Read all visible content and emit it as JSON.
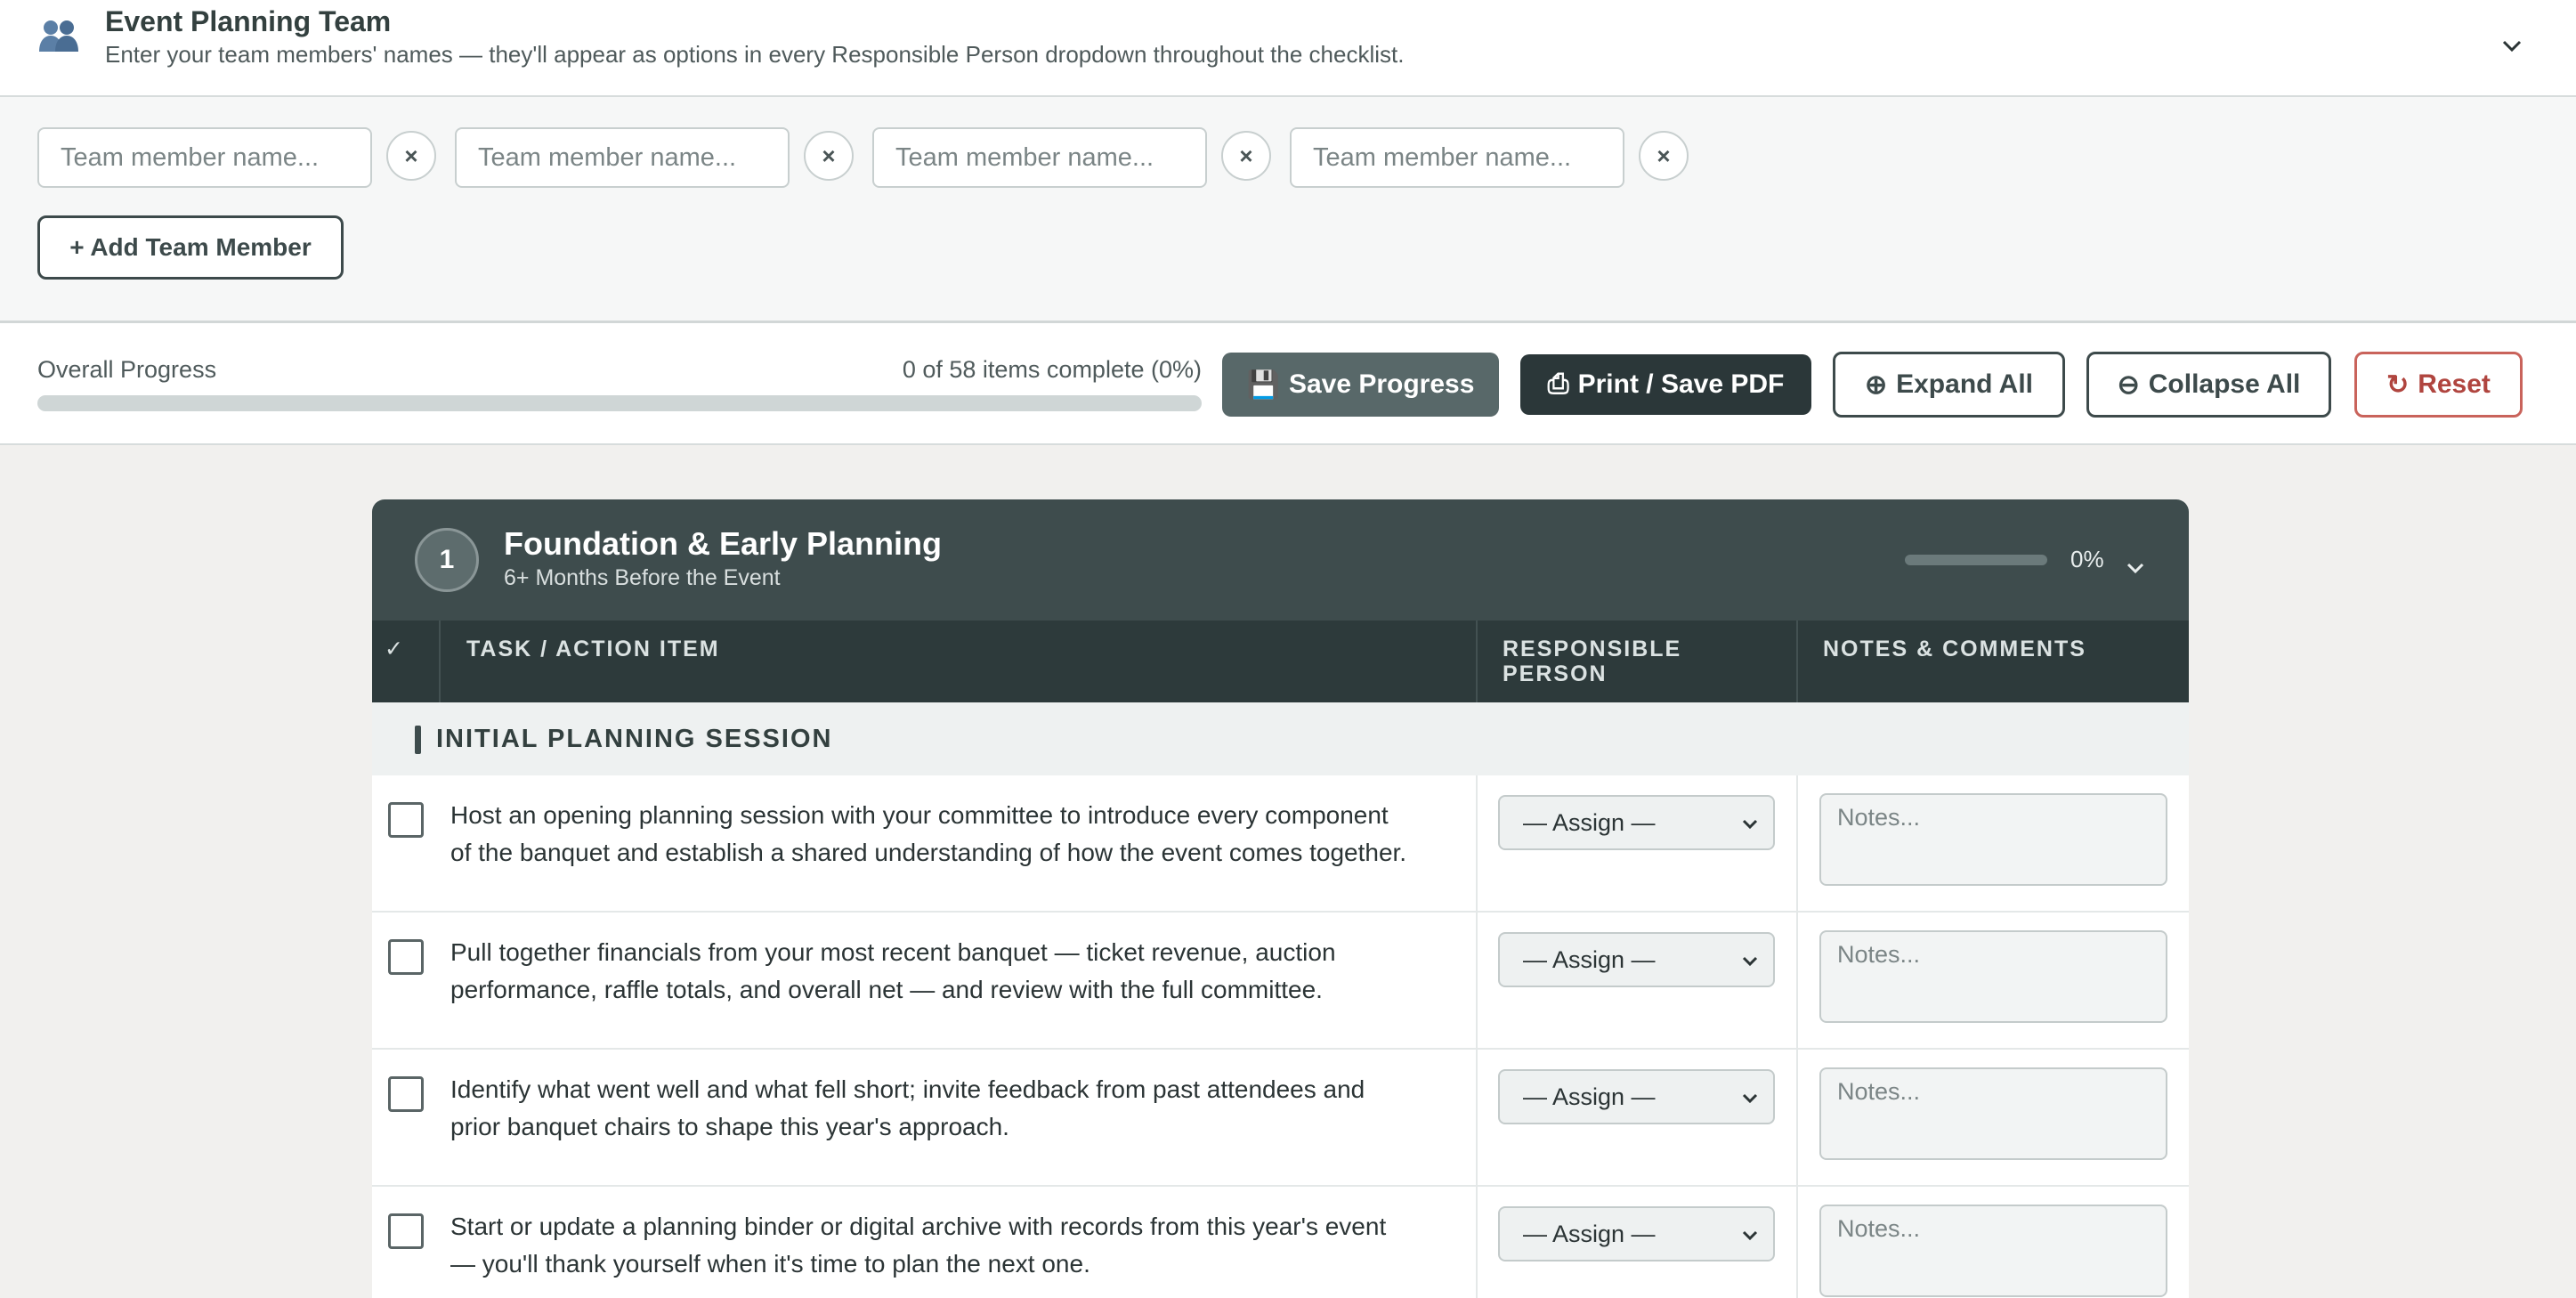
{
  "team": {
    "title": "Event Planning Team",
    "subtitle": "Enter your team members' names — they'll appear as options in every Responsible Person dropdown throughout the checklist.",
    "member_placeholder": "Team member name...",
    "remove_label": "×",
    "add_label": "+ Add Team Member",
    "icon": "people-icon",
    "toggle_icon": "chevron-down-icon"
  },
  "progress": {
    "label": "Overall Progress",
    "count_text": "0 of 58 items complete (0%)",
    "completed": 0,
    "total": 58,
    "fraction": 0
  },
  "toolbar": {
    "save_icon": "💾",
    "save_label": "Save Progress",
    "print_icon": "⎙",
    "print_label": "Print / Save PDF",
    "expand_icon": "⊕",
    "expand_label": "Expand All",
    "collapse_icon": "⊖",
    "collapse_label": "Collapse All",
    "reset_icon": "↻",
    "reset_label": "Reset"
  },
  "section": {
    "number": "1",
    "title": "Foundation & Early Planning",
    "subtitle": "6+ Months Before the Event",
    "percent_text": "0%",
    "fraction": 0,
    "columns": {
      "check": "✓",
      "task": "TASK / ACTION ITEM",
      "person": "RESPONSIBLE PERSON",
      "notes": "NOTES & COMMENTS"
    },
    "group_label": "INITIAL PLANNING SESSION",
    "assign_label": "— Assign —",
    "notes_placeholder": "Notes...",
    "tasks": [
      {
        "text": "Host an opening planning session with your committee to introduce every component of the banquet and establish a shared understanding of how the event comes together."
      },
      {
        "text": "Pull together financials from your most recent banquet — ticket revenue, auction performance, raffle totals, and overall net — and review with the full committee."
      },
      {
        "text": "Identify what went well and what fell short; invite feedback from past attendees and prior banquet chairs to shape this year's approach."
      },
      {
        "text": "Start or update a planning binder or digital archive with records from this year's event — you'll thank yourself when it's time to plan the next one."
      }
    ]
  },
  "colors": {
    "header_dark": "#3e4c4d",
    "column_header": "#2d3a3b",
    "reset_accent": "#c9635b"
  }
}
